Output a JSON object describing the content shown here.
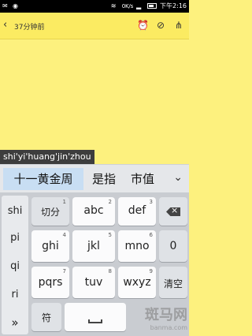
{
  "status_bar": {
    "net_speed": "0K/s",
    "time": "下午2:16"
  },
  "header": {
    "back_icon": "‹",
    "time_ago": "37分钟前",
    "icons": [
      "alarm-icon",
      "attachment-icon",
      "share-icon"
    ]
  },
  "ime": {
    "composition": "shi'yi'huang'jin'zhou",
    "candidates": [
      "十一黄金周",
      "是指",
      "市值"
    ],
    "expand_icon": "chevron-down-icon"
  },
  "keyboard": {
    "left_column": [
      "shi",
      "pi",
      "qi",
      "ri",
      "»"
    ],
    "rows": [
      [
        {
          "label": "切分",
          "num": "1"
        },
        {
          "label": "abc",
          "num": "2"
        },
        {
          "label": "def",
          "num": "3"
        },
        {
          "label": "",
          "num": "",
          "icon": "backspace-icon"
        }
      ],
      [
        {
          "label": "ghi",
          "num": "4"
        },
        {
          "label": "jkl",
          "num": "5"
        },
        {
          "label": "mno",
          "num": "6"
        },
        {
          "label": "0",
          "num": ""
        }
      ],
      [
        {
          "label": "pqrs",
          "num": "7"
        },
        {
          "label": "tuv",
          "num": "8"
        },
        {
          "label": "wxyz",
          "num": "9"
        },
        {
          "label": "清空",
          "num": ""
        }
      ],
      [
        {
          "label": "符",
          "num": ""
        },
        {
          "label": "",
          "num": "",
          "icon": "space-icon"
        }
      ]
    ]
  },
  "watermark": {
    "title": "斑马网",
    "url": "banma.com"
  }
}
